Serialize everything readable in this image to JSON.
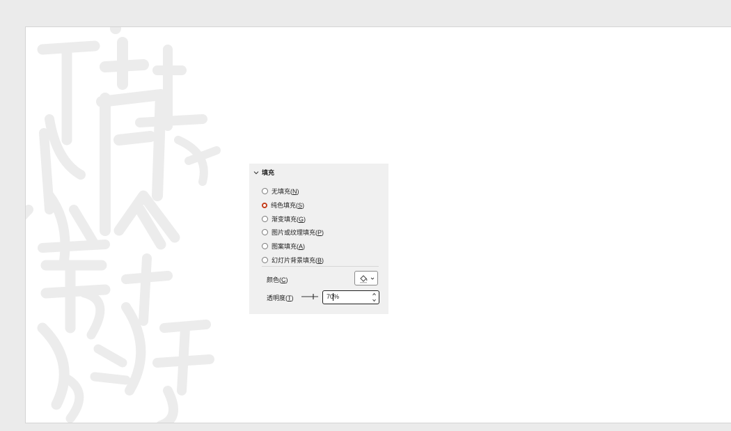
{
  "fill_section": {
    "title": "填充",
    "options": [
      {
        "text": "无填充(",
        "key": "N",
        "close": ")",
        "selected": false
      },
      {
        "text": "纯色填充(",
        "key": "S",
        "close": ")",
        "selected": true
      },
      {
        "text": "渐变填充(",
        "key": "G",
        "close": ")",
        "selected": false
      },
      {
        "text": "图片或纹理填充(",
        "key": "P",
        "close": ")",
        "selected": false
      },
      {
        "text": "图案填充(",
        "key": "A",
        "close": ")",
        "selected": false
      },
      {
        "text": "幻灯片背景填充(",
        "key": "B",
        "close": ")",
        "selected": false
      }
    ],
    "color": {
      "text": "颜色(",
      "key": "C",
      "close": ")",
      "icon": "paint-bucket-icon"
    },
    "transparency": {
      "text": "透明度(",
      "key": "T",
      "close": ")",
      "value": "70%"
    }
  },
  "colors": {
    "accent": "#c43e1c",
    "panel_bg": "#f0f0f0"
  }
}
